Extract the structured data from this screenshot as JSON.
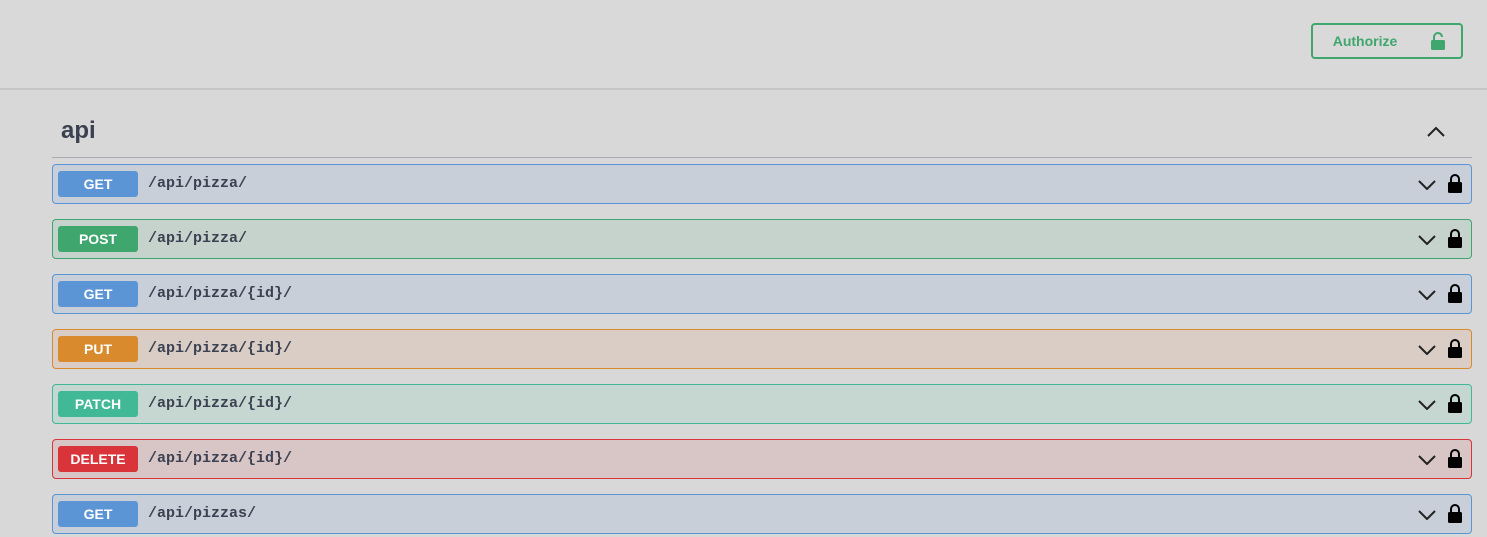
{
  "topbar": {
    "authorize_label": "Authorize",
    "authorize_icon": "unlock-icon",
    "authorize_color": "#3fa66e"
  },
  "section": {
    "title": "api",
    "toggle_icon": "chevron-up-icon"
  },
  "method_colors": {
    "GET": "#5b95d6",
    "POST": "#3fa66e",
    "PUT": "#d88a2d",
    "PATCH": "#41b996",
    "DELETE": "#d9343a"
  },
  "operations": [
    {
      "method": "GET",
      "path": "/api/pizza/"
    },
    {
      "method": "POST",
      "path": "/api/pizza/"
    },
    {
      "method": "GET",
      "path": "/api/pizza/{id}/"
    },
    {
      "method": "PUT",
      "path": "/api/pizza/{id}/"
    },
    {
      "method": "PATCH",
      "path": "/api/pizza/{id}/"
    },
    {
      "method": "DELETE",
      "path": "/api/pizza/{id}/"
    },
    {
      "method": "GET",
      "path": "/api/pizzas/"
    }
  ]
}
